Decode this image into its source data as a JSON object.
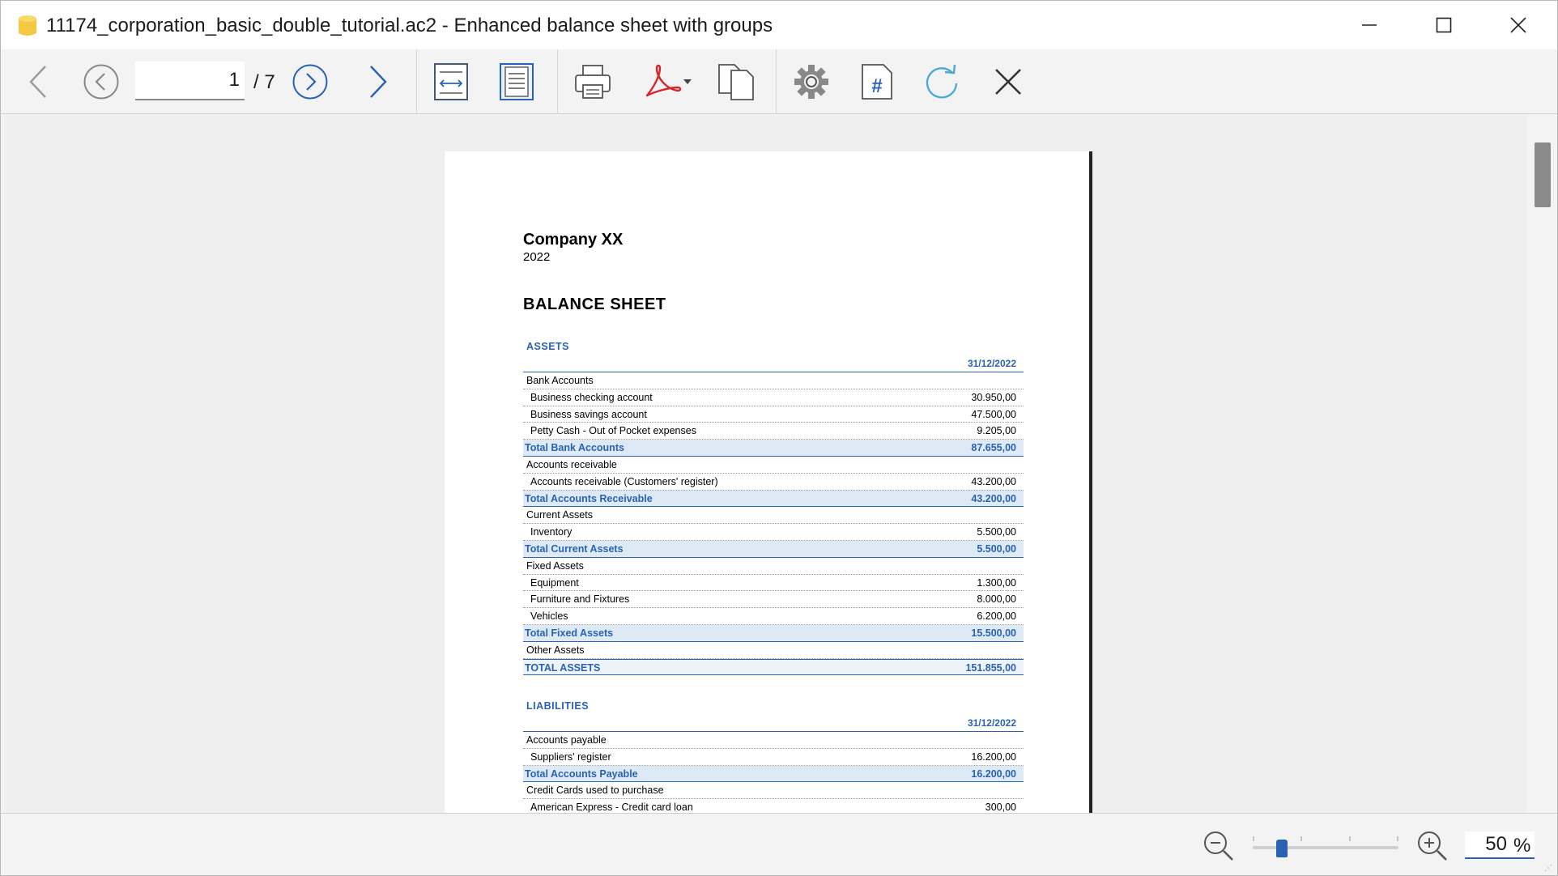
{
  "window": {
    "title": "11174_corporation_basic_double_tutorial.ac2 - Enhanced balance sheet with groups"
  },
  "toolbar": {
    "current_page": "1",
    "page_total": "/ 7",
    "icons": [
      "back-arrow-icon",
      "previous-page-icon",
      "next-page-icon",
      "forward-arrow-icon",
      "fit-width-icon",
      "fit-page-icon",
      "print-icon",
      "pdf-icon",
      "copy-icon",
      "settings-icon",
      "page-numbering-icon",
      "refresh-icon",
      "close-icon"
    ]
  },
  "report": {
    "company": "Company XX",
    "year": "2022",
    "title": "BALANCE SHEET",
    "assets": {
      "heading": "ASSETS",
      "date_header": "31/12/2022",
      "rows": [
        {
          "type": "group",
          "label": "Bank Accounts",
          "amount": ""
        },
        {
          "type": "item",
          "label": "Business checking account",
          "amount": "30.950,00"
        },
        {
          "type": "item",
          "label": "Business savings account",
          "amount": "47.500,00"
        },
        {
          "type": "item",
          "label": "Petty Cash - Out of Pocket expenses",
          "amount": "9.205,00"
        },
        {
          "type": "total",
          "label": "Total Bank Accounts",
          "amount": "87.655,00"
        },
        {
          "type": "group",
          "label": "Accounts receivable",
          "amount": ""
        },
        {
          "type": "item",
          "label": "Accounts receivable (Customers' register)",
          "amount": "43.200,00"
        },
        {
          "type": "total",
          "label": "Total Accounts Receivable",
          "amount": "43.200,00"
        },
        {
          "type": "group",
          "label": "Current Assets",
          "amount": ""
        },
        {
          "type": "item",
          "label": "Inventory",
          "amount": "5.500,00"
        },
        {
          "type": "total",
          "label": "Total Current Assets",
          "amount": "5.500,00"
        },
        {
          "type": "group",
          "label": "Fixed Assets",
          "amount": ""
        },
        {
          "type": "item",
          "label": "Equipment",
          "amount": "1.300,00"
        },
        {
          "type": "item",
          "label": "Furniture and Fixtures",
          "amount": "8.000,00"
        },
        {
          "type": "item",
          "label": "Vehicles",
          "amount": "6.200,00"
        },
        {
          "type": "total",
          "label": "Total Fixed Assets",
          "amount": "15.500,00"
        },
        {
          "type": "group",
          "label": "Other Assets",
          "amount": ""
        },
        {
          "type": "grand",
          "label": "TOTAL ASSETS",
          "amount": "151.855,00"
        }
      ]
    },
    "liabilities": {
      "heading": "LIABILITIES",
      "date_header": "31/12/2022",
      "rows": [
        {
          "type": "group",
          "label": "Accounts payable",
          "amount": ""
        },
        {
          "type": "item",
          "label": "Suppliers' register",
          "amount": "16.200,00"
        },
        {
          "type": "total",
          "label": "Total Accounts Payable",
          "amount": "16.200,00"
        },
        {
          "type": "group",
          "label": "Credit Cards used to purchase",
          "amount": ""
        },
        {
          "type": "item",
          "label": "American Express - Credit card loan",
          "amount": "300,00"
        }
      ]
    }
  },
  "statusbar": {
    "zoom_value": "50",
    "zoom_unit": "%",
    "zoom_level": 0.2
  },
  "colors": {
    "accent": "#2a62b3",
    "total_row_bg": "#dde9f5"
  }
}
